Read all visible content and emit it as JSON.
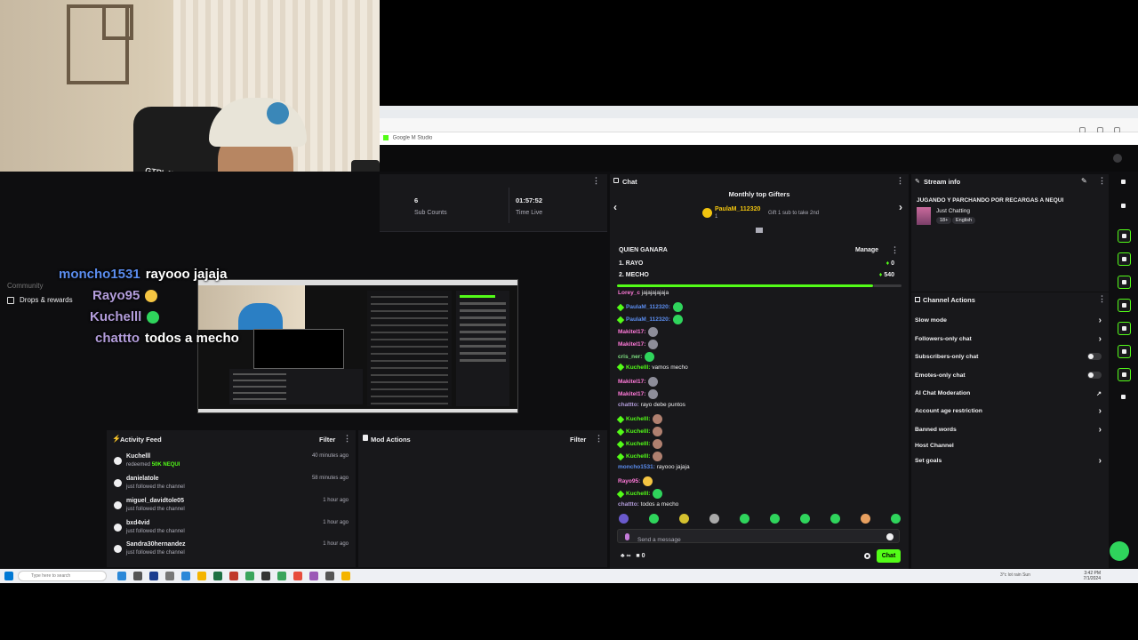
{
  "overlay_chat": [
    {
      "user": "moncho1531",
      "msg": "rayooo jajaja"
    },
    {
      "user": "Rayo95",
      "msg": ""
    },
    {
      "user": "Kuchelll",
      "msg": ""
    },
    {
      "user": "chattto",
      "msg": "todos a mecho"
    }
  ],
  "left_nav": {
    "community": "Community",
    "drops": "Drops & rewards"
  },
  "stats": {
    "sub_count_value": "6",
    "sub_count_label": "Sub Counts",
    "time_live_value": "01:57:52",
    "time_live_label": "Time Live"
  },
  "activity_feed": {
    "title": "Activity Feed",
    "filter": "Filter",
    "items": [
      {
        "name": "Kuchelll",
        "desc": "redeemed",
        "reward": "50K NEQUI",
        "time": "40 minutes ago"
      },
      {
        "name": "danielatole",
        "desc": "just followed the channel",
        "time": "58 minutes ago"
      },
      {
        "name": "miguel_davidtole05",
        "desc": "just followed the channel",
        "time": "1 hour ago"
      },
      {
        "name": "bxd4vid",
        "desc": "just followed the channel",
        "time": "1 hour ago"
      },
      {
        "name": "Sandra30hernandez",
        "desc": "just followed the channel",
        "time": "1 hour ago"
      }
    ]
  },
  "mod_actions": {
    "title": "Mod Actions",
    "filter": "Filter"
  },
  "chat": {
    "title": "Chat",
    "gifters_title": "Monthly top Gifters",
    "top_gifter": "PaulaM_112320",
    "top_gifter_count": "1",
    "gifter_note": "Gift 1 sub to take 2nd",
    "poll": {
      "title": "QUIEN GANARA",
      "manage": "Manage",
      "options": [
        {
          "label": "1. RAYO",
          "value": "0"
        },
        {
          "label": "2. MECHO",
          "value": "540"
        }
      ],
      "progress_fraction": 0.9
    },
    "messages": [
      {
        "user": "Lorey_c",
        "text": "jajajajajaja",
        "cls": "pink"
      },
      {
        "user": "PaulaM_112320:",
        "text": "",
        "cls": "blue",
        "badge": true
      },
      {
        "user": "PaulaM_112320:",
        "text": "",
        "cls": "blue",
        "badge": true
      },
      {
        "user": "Makitel17:",
        "text": "",
        "cls": "pink"
      },
      {
        "user": "Makitel17:",
        "text": "",
        "cls": "pink"
      },
      {
        "user": "cris_ner:",
        "text": "",
        "cls": "lime"
      },
      {
        "user": "Kuchelll:",
        "text": "vamos mecho",
        "cls": "green",
        "badge": true
      },
      {
        "user": "Makitel17:",
        "text": "",
        "cls": "pink"
      },
      {
        "user": "Makitel17:",
        "text": "",
        "cls": "pink"
      },
      {
        "user": "chattto:",
        "text": "rayo debe puntos",
        "cls": "purple"
      },
      {
        "user": "Kuchelll:",
        "text": "",
        "cls": "green",
        "badge": true
      },
      {
        "user": "Kuchelll:",
        "text": "",
        "cls": "green",
        "badge": true
      },
      {
        "user": "Kuchelll:",
        "text": "",
        "cls": "green",
        "badge": true
      },
      {
        "user": "Kuchelll:",
        "text": "",
        "cls": "green",
        "badge": true
      },
      {
        "user": "moncho1531:",
        "text": "rayooo jajaja",
        "cls": "blue"
      },
      {
        "user": "Rayo95:",
        "text": "",
        "cls": "pink"
      },
      {
        "user": "Kuchelll:",
        "text": "",
        "cls": "green",
        "badge": true
      },
      {
        "user": "chattto:",
        "text": "todos a mecho",
        "cls": "purple"
      }
    ],
    "input_placeholder": "Send a message",
    "footer_count_a": "∞",
    "footer_count_b": "0",
    "send_label": "Chat"
  },
  "stream_info": {
    "title": "Stream info",
    "stream_title": "JUGANDO Y PARCHANDO POR RECARGAS A NEQUI",
    "category": "Just Chatting",
    "tags": [
      "18+",
      "English"
    ]
  },
  "channel_actions": {
    "title": "Channel Actions",
    "items": [
      {
        "label": "Slow mode",
        "control": "chevron"
      },
      {
        "label": "Followers-only chat",
        "control": "chevron"
      },
      {
        "label": "Subscribers-only chat",
        "control": "toggle"
      },
      {
        "label": "Emotes-only chat",
        "control": "toggle"
      },
      {
        "label": "AI Chat Moderation",
        "control": "external"
      },
      {
        "label": "Account age restriction",
        "control": "chevron"
      },
      {
        "label": "Banned words",
        "control": "chevron"
      },
      {
        "label": "Host Channel",
        "control": "none"
      },
      {
        "label": "Set goals",
        "control": "chevron"
      }
    ]
  },
  "browser": {
    "bookmark": "Google M Studio"
  },
  "taskbar": {
    "search_placeholder": "Type here to search",
    "weather": "3°c lot rain Sun",
    "time": "3:42 PM",
    "date": "7/1/2024"
  },
  "colors": {
    "accent": "#53fc18",
    "panel": "#18181b",
    "background": "#0e0e10"
  }
}
